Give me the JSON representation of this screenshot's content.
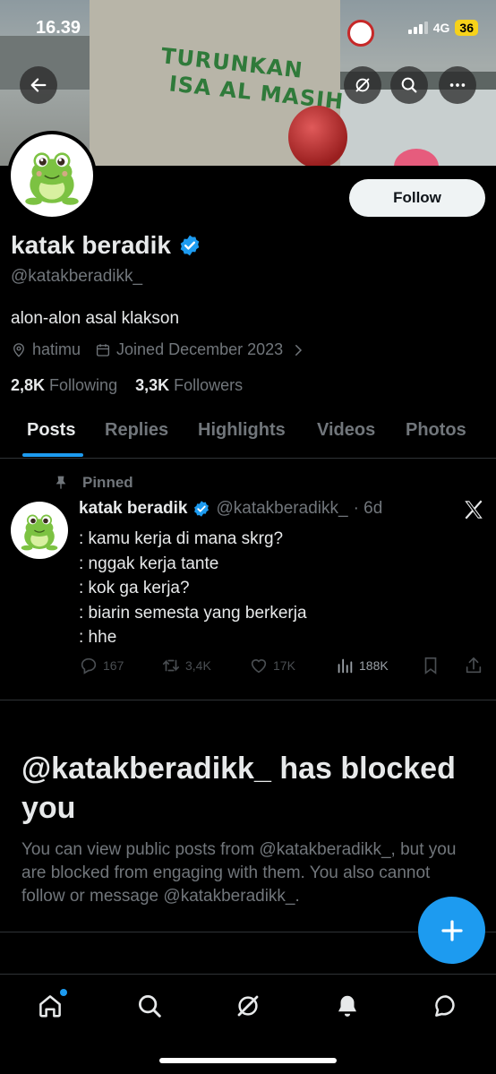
{
  "status_bar": {
    "time": "16.39",
    "network": "4G",
    "battery": "36"
  },
  "banner": {
    "graffiti_line1": "TURUNKAN",
    "graffiti_line2": "ISA AL MASIH"
  },
  "profile": {
    "name": "katak beradik",
    "handle": "@katakberadikk_",
    "bio": "alon-alon asal klakson",
    "location": "hatimu",
    "joined": "Joined December 2023",
    "following_count": "2,8K",
    "following_label": "Following",
    "followers_count": "3,3K",
    "followers_label": "Followers",
    "follow_label": "Follow"
  },
  "tabs": [
    "Posts",
    "Replies",
    "Highlights",
    "Videos",
    "Photos"
  ],
  "post": {
    "pinned_label": "Pinned",
    "author": "katak beradik",
    "handle": "@katakberadikk_",
    "time": "· 6d",
    "lines": [
      ": kamu kerja di mana skrg?",
      ": nggak kerja tante",
      ": kok ga kerja?",
      ": biarin semesta yang berkerja",
      ": hhe"
    ],
    "replies": "167",
    "reposts": "3,4K",
    "likes": "17K",
    "views": "188K"
  },
  "blocked": {
    "title": "@katakberadikk_ has blocked you",
    "text": "You can view public posts from @katakberadikk_, but you are blocked from engaging with them. You also cannot follow or message @katakberadikk_."
  },
  "icons": {
    "back": "arrow-left-icon",
    "grok": "grok-icon",
    "search": "search-icon",
    "more": "more-icon",
    "verified": "verified-badge-icon",
    "location": "location-icon",
    "calendar": "calendar-icon",
    "pin": "pin-icon",
    "x_logo": "x-logo-icon",
    "compose": "plus-icon"
  },
  "colors": {
    "accent": "#1d9bf0",
    "background": "#000000",
    "muted": "#71767b",
    "text": "#e7e9ea"
  }
}
